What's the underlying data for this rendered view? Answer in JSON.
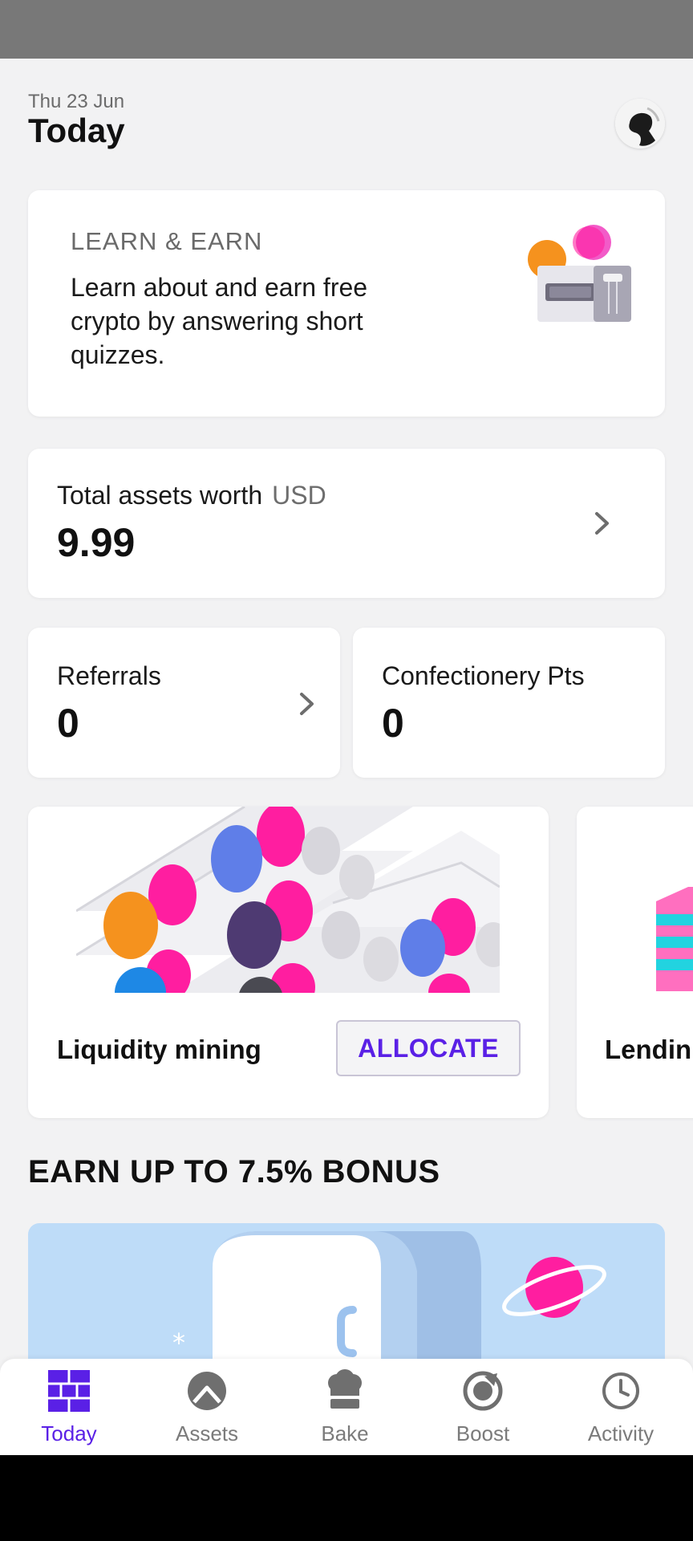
{
  "header": {
    "date": "Thu 23 Jun",
    "title": "Today"
  },
  "learn_card": {
    "eyebrow": "LEARN & EARN",
    "text": "Learn about and earn free crypto by answering short quizzes."
  },
  "assets_card": {
    "label": "Total assets worth",
    "currency": "USD",
    "value": "9.99"
  },
  "referrals_card": {
    "label": "Referrals",
    "value": "0"
  },
  "confectionery_card": {
    "label": "Confectionery Pts",
    "value": "0"
  },
  "products": [
    {
      "title": "Liquidity mining",
      "button_label": "ALLOCATE"
    },
    {
      "title": "Lendin"
    }
  ],
  "bonus_section": {
    "heading": "EARN UP TO 7.5% BONUS"
  },
  "nav": {
    "items": [
      {
        "label": "Today",
        "icon": "bricks-icon",
        "active": true
      },
      {
        "label": "Assets",
        "icon": "assets-icon",
        "active": false
      },
      {
        "label": "Bake",
        "icon": "chef-hat-icon",
        "active": false
      },
      {
        "label": "Boost",
        "icon": "boost-icon",
        "active": false
      },
      {
        "label": "Activity",
        "icon": "clock-icon",
        "active": false
      }
    ]
  },
  "colors": {
    "accent": "#5a20e6",
    "background": "#f2f2f3",
    "card": "#ffffff",
    "pink": "#ff1ea0",
    "orange": "#f5921e",
    "blue": "#5f7ee8",
    "purple": "#4e3a72",
    "banner": "#bedcf8"
  }
}
